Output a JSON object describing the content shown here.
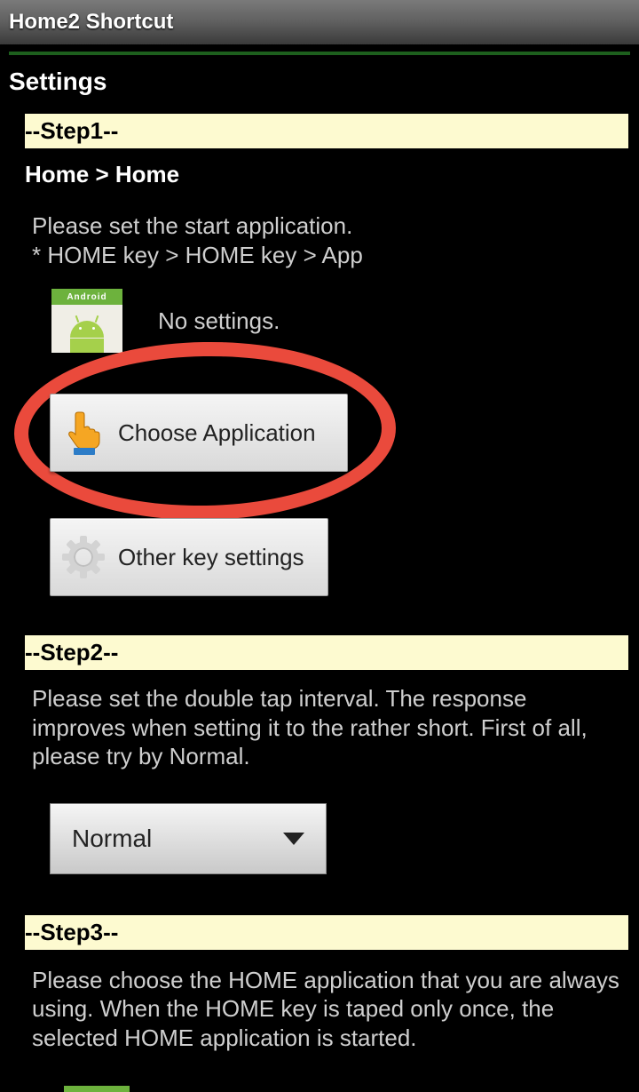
{
  "titlebar": {
    "title": "Home2 Shortcut"
  },
  "page": {
    "title": "Settings"
  },
  "step1": {
    "header": "--Step1--",
    "breadcrumb": "Home > Home",
    "desc": "Please set the start application.\n * HOME key > HOME key > App",
    "status": "No settings.",
    "btn_choose": "Choose Application",
    "btn_other": "Other key settings"
  },
  "step2": {
    "header": "--Step2--",
    "desc": "Please set the double tap interval. The response improves when setting it to the rather short. First of all, please try by Normal.",
    "dropdown_value": "Normal"
  },
  "step3": {
    "header": "--Step3--",
    "desc": "Please choose the HOME application that you are always using. When the HOME key is taped only once, the selected HOME application is started."
  }
}
